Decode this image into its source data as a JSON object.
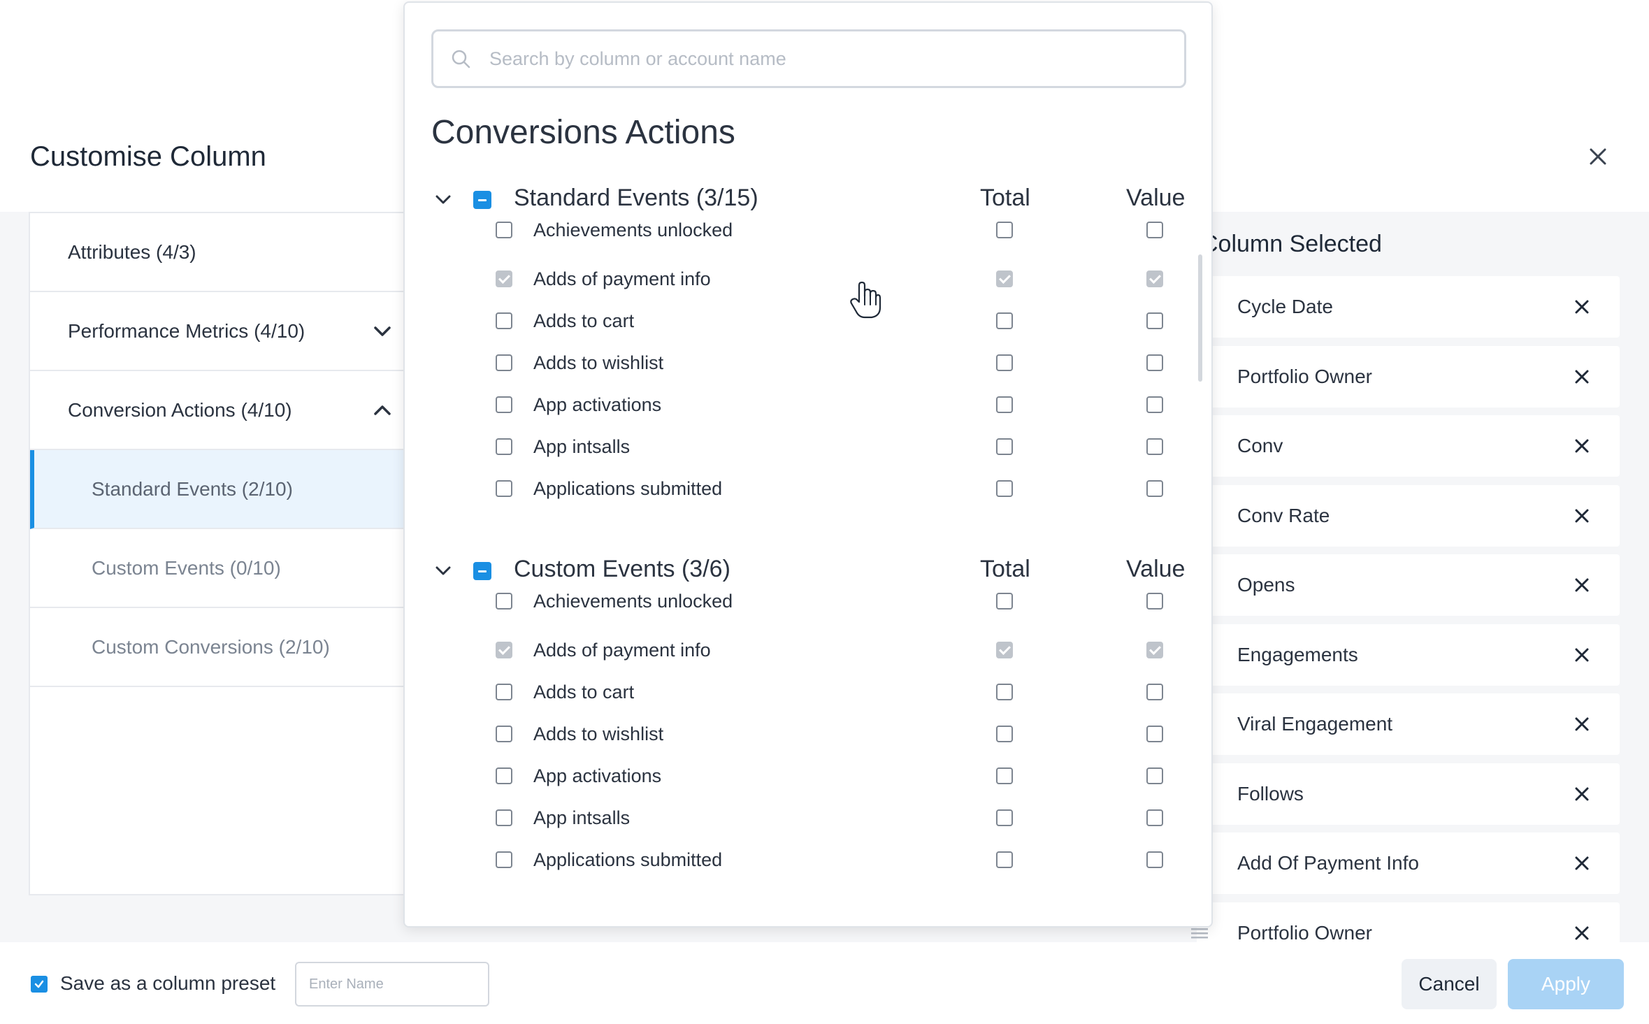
{
  "modal": {
    "title": "Customise Column",
    "close_icon": "close-icon"
  },
  "left_nav": {
    "items": [
      {
        "label": "Attributes (4/3)"
      },
      {
        "label": "Performance Metrics (4/10)",
        "icon": "chevron-down-icon"
      },
      {
        "label": "Conversion Actions (4/10)",
        "icon": "chevron-up-icon"
      },
      {
        "label": "Standard Events (2/10)",
        "active": true
      },
      {
        "label": "Custom Events (0/10)"
      },
      {
        "label": "Custom Conversions (2/10)"
      }
    ]
  },
  "dropdown": {
    "search_placeholder": "Search by column or account name",
    "title": "Conversions Actions",
    "groups": [
      {
        "title": "Standard Events (3/15)",
        "col_total": "Total",
        "col_value": "Value",
        "rows": [
          {
            "label": "Achievements unlocked",
            "checked": false,
            "total": false,
            "value": false
          },
          {
            "label": "Adds of payment info",
            "checked": true,
            "total": true,
            "value": true
          },
          {
            "label": "Adds to cart",
            "checked": false,
            "total": false,
            "value": false
          },
          {
            "label": "Adds to wishlist",
            "checked": false,
            "total": false,
            "value": false
          },
          {
            "label": "App activations",
            "checked": false,
            "total": false,
            "value": false
          },
          {
            "label": "App intsalls",
            "checked": false,
            "total": false,
            "value": false
          },
          {
            "label": "Applications submitted",
            "checked": false,
            "total": false,
            "value": false
          }
        ]
      },
      {
        "title": "Custom Events (3/6)",
        "col_total": "Total",
        "col_value": "Value",
        "rows": [
          {
            "label": "Achievements unlocked",
            "checked": false,
            "total": false,
            "value": false
          },
          {
            "label": "Adds of payment info",
            "checked": true,
            "total": true,
            "value": true
          },
          {
            "label": "Adds to cart",
            "checked": false,
            "total": false,
            "value": false
          },
          {
            "label": "Adds to wishlist",
            "checked": false,
            "total": false,
            "value": false
          },
          {
            "label": "App activations",
            "checked": false,
            "total": false,
            "value": false
          },
          {
            "label": "App intsalls",
            "checked": false,
            "total": false,
            "value": false
          },
          {
            "label": "Applications submitted",
            "checked": false,
            "total": false,
            "value": false
          }
        ]
      }
    ]
  },
  "selected": {
    "title": "Column Selected",
    "items": [
      "Cycle Date",
      "Portfolio Owner",
      "Conv",
      "Conv Rate",
      "Opens",
      "Engagements",
      "Viral Engagement",
      "Follows",
      "Add Of Payment Info",
      "Portfolio Owner"
    ]
  },
  "footer": {
    "preset_label": "Save as a column preset",
    "name_placeholder": "Enter Name",
    "cancel_label": "Cancel",
    "apply_label": "Apply"
  },
  "colors": {
    "accent": "#1a8fe3",
    "active_bg": "#eaf4fd",
    "apply_disabled": "#a9d3f5"
  }
}
